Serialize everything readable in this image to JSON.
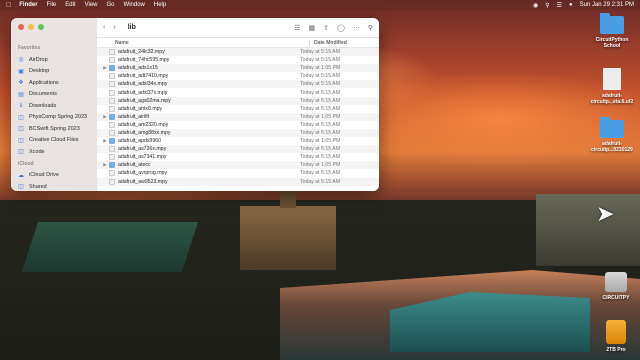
{
  "menubar": {
    "apple_icon": "apple-icon",
    "items": [
      "Finder",
      "File",
      "Edit",
      "View",
      "Go",
      "Window",
      "Help"
    ],
    "clock": "Sun Jan 29  2:31 PM"
  },
  "finder": {
    "folder_title": "lib",
    "sidebar": {
      "favorites_head": "Favorites",
      "favorites": [
        "AirDrop",
        "Desktop",
        "Applications",
        "Documents",
        "Downloads",
        "PhysComp Spring 2023",
        "BCSwift Spring 2023",
        "Creative Cloud Files",
        "Xcode"
      ],
      "icloud_head": "iCloud",
      "icloud": [
        "iCloud Drive",
        "Shared"
      ]
    },
    "columns": {
      "name": "Name",
      "date": "Date Modified"
    },
    "rows": [
      {
        "name": "adafruit_24lc32.mpy",
        "date": "Today at 5:15 AM",
        "kind": "file",
        "expandable": false
      },
      {
        "name": "adafruit_74hc595.mpy",
        "date": "Today at 5:15 AM",
        "kind": "file",
        "expandable": false
      },
      {
        "name": "adafruit_ads1x15",
        "date": "Today at 1:05 PM",
        "kind": "folder",
        "expandable": true
      },
      {
        "name": "adafruit_adt7410.mpy",
        "date": "Today at 5:15 AM",
        "kind": "file",
        "expandable": false
      },
      {
        "name": "adafruit_adxl34x.mpy",
        "date": "Today at 5:15 AM",
        "kind": "file",
        "expandable": false
      },
      {
        "name": "adafruit_adxl37x.mpy",
        "date": "Today at 5:15 AM",
        "kind": "file",
        "expandable": false
      },
      {
        "name": "adafruit_ags02ma.mpy",
        "date": "Today at 5:15 AM",
        "kind": "file",
        "expandable": false
      },
      {
        "name": "adafruit_ahtx0.mpy",
        "date": "Today at 5:15 AM",
        "kind": "file",
        "expandable": false
      },
      {
        "name": "adafruit_airlift",
        "date": "Today at 1:05 PM",
        "kind": "folder",
        "expandable": true
      },
      {
        "name": "adafruit_am2320.mpy",
        "date": "Today at 5:15 AM",
        "kind": "file",
        "expandable": false
      },
      {
        "name": "adafruit_amg88xx.mpy",
        "date": "Today at 5:15 AM",
        "kind": "file",
        "expandable": false
      },
      {
        "name": "adafruit_apds9960",
        "date": "Today at 1:05 PM",
        "kind": "folder",
        "expandable": true
      },
      {
        "name": "adafruit_as726x.mpy",
        "date": "Today at 5:15 AM",
        "kind": "file",
        "expandable": false
      },
      {
        "name": "adafruit_as7341.mpy",
        "date": "Today at 5:15 AM",
        "kind": "file",
        "expandable": false
      },
      {
        "name": "adafruit_atecc",
        "date": "Today at 1:05 PM",
        "kind": "folder",
        "expandable": true
      },
      {
        "name": "adafruit_avrprog.mpy",
        "date": "Today at 5:15 AM",
        "kind": "file",
        "expandable": false
      },
      {
        "name": "adafruit_aw9523.mpy",
        "date": "Today at 5:15 AM",
        "kind": "file",
        "expandable": false
      }
    ]
  },
  "desktop": {
    "icons": [
      {
        "label": "CircuitPython School",
        "type": "folder"
      },
      {
        "label": "adafruit-circuitp...eta.6.uf2",
        "type": "file"
      },
      {
        "label": "adafruit-circuitp...0230129",
        "type": "folder"
      },
      {
        "label": "CIRCUITPY",
        "type": "drive"
      },
      {
        "label": "2TB Pro",
        "type": "drive-orange"
      }
    ]
  }
}
